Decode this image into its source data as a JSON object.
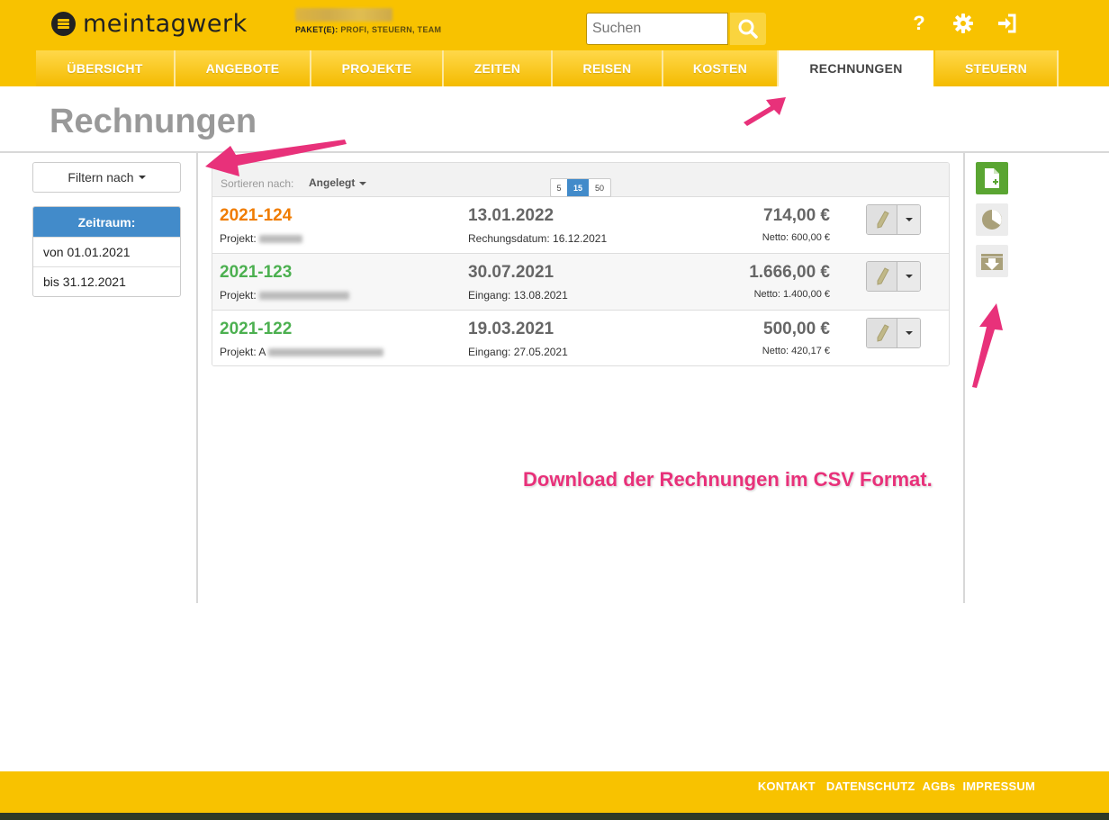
{
  "header": {
    "logo_text": "meintagwerk",
    "paket_label": "PAKET(E):",
    "paket_value": "PROFI, STEUERN, TEAM",
    "search_placeholder": "Suchen"
  },
  "nav": {
    "tabs": [
      {
        "label": "ÜBERSICHT"
      },
      {
        "label": "ANGEBOTE"
      },
      {
        "label": "PROJEKTE"
      },
      {
        "label": "ZEITEN"
      },
      {
        "label": "REISEN"
      },
      {
        "label": "KOSTEN"
      },
      {
        "label": "RECHNUNGEN"
      },
      {
        "label": "STEUERN"
      }
    ],
    "active": "RECHNUNGEN"
  },
  "page_title": "Rechnungen",
  "sidebar": {
    "filter_label": "Filtern nach",
    "zeitraum_title": "Zeitraum:",
    "from": "von 01.01.2021",
    "to": "bis 31.12.2021"
  },
  "list": {
    "sort_label": "Sortieren nach:",
    "sort_value": "Angelegt",
    "page_sizes": [
      "5",
      "15",
      "50"
    ],
    "selected_page_size": "15",
    "rows": [
      {
        "number": "2021-124",
        "number_color": "#f07c00",
        "project_label": "Projekt:",
        "date": "13.01.2022",
        "date_sub": "Rechungsdatum: 16.12.2021",
        "amount": "714,00 €",
        "netto": "Netto: 600,00 €"
      },
      {
        "number": "2021-123",
        "number_color": "#4cb050",
        "project_label": "Projekt:",
        "date": "30.07.2021",
        "date_sub": "Eingang: 13.08.2021",
        "amount": "1.666,00 €",
        "netto": "Netto: 1.400,00 €"
      },
      {
        "number": "2021-122",
        "number_color": "#4cb050",
        "project_label": "Projekt: A",
        "date": "19.03.2021",
        "date_sub": "Eingang: 27.05.2021",
        "amount": "500,00 €",
        "netto": "Netto: 420,17 €"
      }
    ]
  },
  "annotation": "Download der Rechnungen im CSV Format.",
  "footer": {
    "links": [
      "KONTAKT",
      "DATENSCHUTZ",
      "AGBs",
      "IMPRESSUM"
    ]
  },
  "colors": {
    "brand_yellow": "#f8c200",
    "accent_blue": "#428bca",
    "annotation_pink": "#e8317a",
    "new_invoice_green": "#5aa532"
  }
}
